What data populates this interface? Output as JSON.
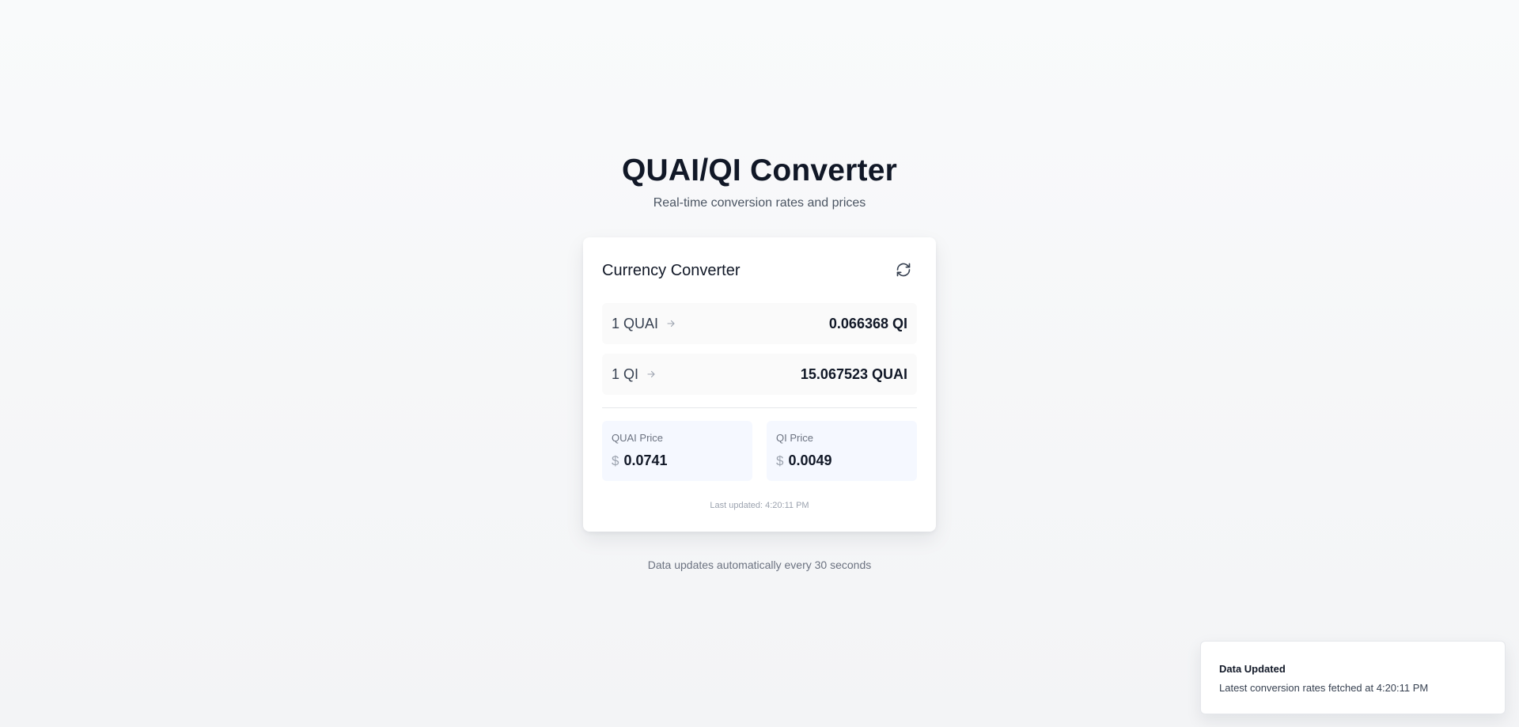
{
  "header": {
    "title": "QUAI/QI Converter",
    "subtitle": "Real-time conversion rates and prices"
  },
  "converter": {
    "title": "Currency Converter",
    "refresh_icon": "refresh-icon",
    "rates": [
      {
        "from": "1 QUAI",
        "to": "0.066368 QI"
      },
      {
        "from": "1 QI",
        "to": "15.067523 QUAI"
      }
    ],
    "prices": [
      {
        "label": "QUAI Price",
        "currency_symbol": "$",
        "value": "0.0741"
      },
      {
        "label": "QI Price",
        "currency_symbol": "$",
        "value": "0.0049"
      }
    ],
    "last_updated": "Last updated: 4:20:11 PM"
  },
  "footer": {
    "note": "Data updates automatically every 30 seconds"
  },
  "toast": {
    "title": "Data Updated",
    "message": "Latest conversion rates fetched at 4:20:11 PM"
  },
  "colors": {
    "background": "#f9fafb",
    "card": "#ffffff",
    "price_box": "#f5f8ff",
    "text_primary": "#111827",
    "text_muted": "#6b7280"
  }
}
